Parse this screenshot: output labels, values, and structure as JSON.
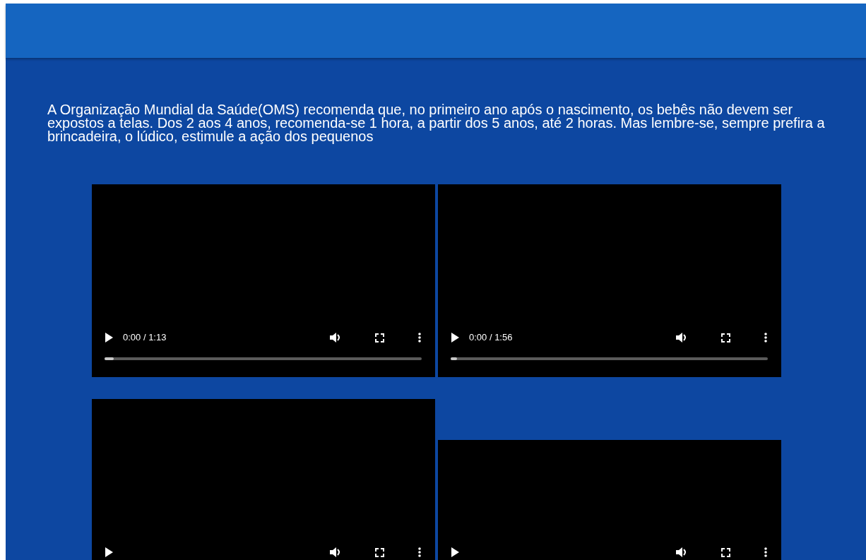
{
  "intro": "A Organização Mundial da Saúde(OMS) recomenda que, no primeiro ano após o nascimento, os bebês não devem ser expostos a telas. Dos 2 aos 4 anos, recomenda-se 1 hora, a partir dos 5 anos, até 2 horas. Mas lembre-se, sempre prefira a brincadeira, o lúdico, estimule a ação dos pequenos",
  "videos": [
    {
      "kind": "player",
      "time": "0:00 / 1:13",
      "level": 0.03
    },
    {
      "kind": "player",
      "time": "0:00 / 1:56",
      "level": 0.02
    },
    {
      "kind": "player"
    },
    {
      "kind": "player"
    }
  ]
}
